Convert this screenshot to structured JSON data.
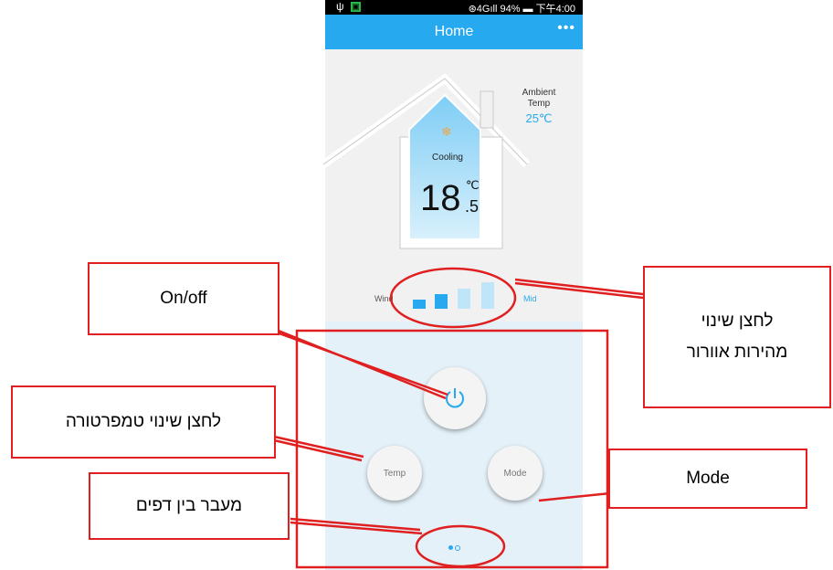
{
  "statusbar": {
    "usb_icon": "usb-icon",
    "app_icon": "app-notification-icon",
    "right_text": "⊛4Gıll 94% ▬ 下午4:00"
  },
  "appbar": {
    "title": "Home",
    "more": "•••"
  },
  "ambient": {
    "label": "Ambient Temp",
    "value": "25℃"
  },
  "house": {
    "mode_icon": "snowflake-icon",
    "mode_label": "Cooling",
    "temp_int": "18",
    "temp_dec": ".5",
    "unit": "℃"
  },
  "wind": {
    "left_label": "Wind",
    "right_label": "Mid",
    "level": 2,
    "levels": 4
  },
  "controls": {
    "temp_label": "Temp",
    "mode_label": "Mode",
    "power_icon": "power-icon"
  },
  "pager": {
    "pages": 2,
    "current": 1
  },
  "annotations": {
    "onoff": "On/off",
    "fan_speed_line1": "לחצן שינוי",
    "fan_speed_line2": "מהירות אוורור",
    "temp_button": "לחצן שינוי טמפרטורה",
    "page_switch": "מעבר בין דפים",
    "mode": "Mode"
  },
  "colors": {
    "accent": "#27a9ef",
    "annotation": "#e02020",
    "panel": "#e4f1f8"
  }
}
